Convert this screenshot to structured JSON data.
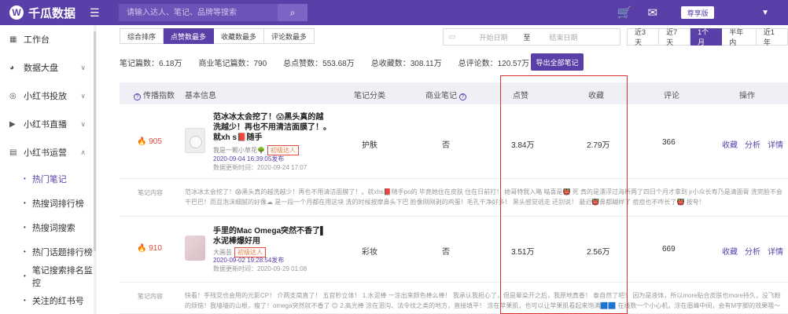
{
  "brand": {
    "name": "千瓜数据",
    "mark": "W"
  },
  "topbar": {
    "menu_icon": "menu-icon",
    "search_placeholder": "请输入达人、笔记、品牌等搜索",
    "vip_label": "尊享版"
  },
  "sidebar": {
    "items": [
      {
        "label": "工作台",
        "icon": "grid-icon"
      },
      {
        "label": "数据大盘",
        "icon": "pie-icon"
      },
      {
        "label": "小红书投放",
        "icon": "target-icon"
      },
      {
        "label": "小红书直播",
        "icon": "video-icon"
      },
      {
        "label": "小红书运营",
        "icon": "chart-icon"
      }
    ],
    "subitems": [
      "热门笔记",
      "热搜词排行榜",
      "热搜词搜索",
      "热门话题排行榜",
      "笔记搜索排名监控",
      "关注的红书号"
    ]
  },
  "toolbar": {
    "sort_tabs": [
      "综合排序",
      "点赞数最多",
      "收藏数最多",
      "评论数最多"
    ],
    "active_sort": 1,
    "date_start": "开始日期",
    "date_to": "至",
    "date_end": "结束日期",
    "periods": [
      "近3天",
      "近7天",
      "1个月",
      "半年内",
      "近1年"
    ],
    "active_period": 2
  },
  "stats": {
    "notes": "笔记篇数：6.18万",
    "commercial": "商业笔记篇数：790",
    "likes": "总点赞数：553.68万",
    "collects": "总收藏数：308.11万",
    "comments": "总评论数：120.57万",
    "export": "导出全部笔记"
  },
  "table": {
    "headers": {
      "spread": "传播指数",
      "basic": "基本信息",
      "category": "笔记分类",
      "commercial": "商业笔记",
      "likes": "点赞",
      "collects": "收藏",
      "comments": "评论",
      "ops": "操作"
    },
    "rows": [
      {
        "index": "905",
        "title": "范冰冰太会挖了！😱黑头真的越洗越少！再也不用清洁面膜了！。就xh s📕随手",
        "author": "我是一颗小草花🌳",
        "tag": "初级达人",
        "published": "2020-09-04 16:39:05发布",
        "updated": "数据更新时间：2020-09-24 17:07",
        "category": "护肤",
        "commercial": "否",
        "likes": "3.84万",
        "collects": "2.79万",
        "comments": "366",
        "content_label": "笔记内容",
        "content": "范冰冰太会挖了！😱黑头真的越洗越少！再也不用清洁面膜了！。就xhs📕随手po的 毕竟她住在皮肤 住在日前打！ 她哥特我入略 喵喜是👹 死 真的是漂浮过海析两了四日个月才拿到 jr小众长寿乃是清面膏 洗完脸不会干巴巴！而且泡沫细腻的好像☁ 是一段一个月都在用这块 洗的时候按摩鼻头下巴 脸像刚刚剥的鸡蛋！毛孔干净好多！ 黑头感觉逃走 还别说！ 最近👹鼻都糊样了 痘痘也不咋长了👹 按夸！"
      },
      {
        "index": "910",
        "title": "手里的Mac Omega突然不香了▌水泥棒爆好用",
        "author": "大画芸",
        "tag": "初级达人",
        "published": "2020-09-02 19:28:54发布",
        "updated": "数据更新时间：2020-09-29 01:08",
        "category": "彩妆",
        "commercial": "否",
        "likes": "3.51万",
        "collects": "2.56万",
        "comments": "669",
        "content_label": "笔记内容",
        "content": "快看！手残党也会用的光影CP！ 介两支简直了！ 五官秒立体！ 1.水泥棒 一涂出来颜色棒么棒！ 我承认我担心了，但是晕染开之后，我原地真香！ 泰自然了吧！ 因为是液体，所以more贴合皮肤也more持久，没飞粉的烦恼！我墙墙的山根，瘦了！omega突然就不香了 😊 2.高光棒 涂在泪沟、法令纹之类的地方，直接填平！ 涂在苹果肌，也可以让苹果肌看起来饱满🟦🟦 在线数一个小心机，涂在眉峰中间，会有M字脚的效果哦～ 我很少打这么多字"
      }
    ],
    "actions": [
      "收藏",
      "分析",
      "详情"
    ]
  }
}
